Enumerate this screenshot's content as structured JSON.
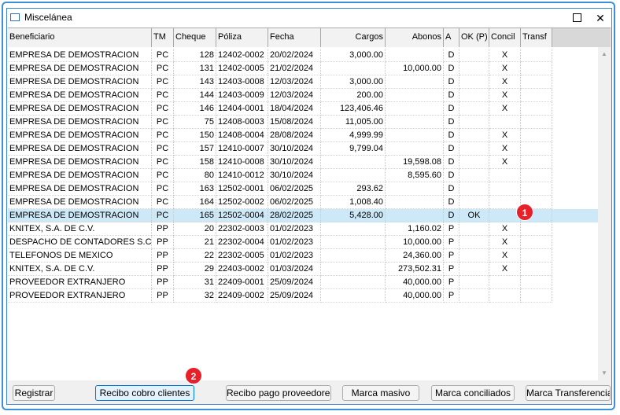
{
  "window": {
    "title": "Miscelánea"
  },
  "columns": [
    "Beneficiario",
    "TM",
    "Cheque",
    "Póliza",
    "Fecha",
    "Cargos",
    "Abonos",
    "A",
    "OK (P)",
    "Concil",
    "Transf"
  ],
  "rows": [
    [
      "EMPRESA DE DEMOSTRACION",
      "PC",
      "128",
      "12402-0002",
      "20/02/2024",
      "3,000.00",
      "",
      "D",
      "",
      "X",
      ""
    ],
    [
      "EMPRESA DE DEMOSTRACION",
      "PC",
      "131",
      "12402-0005",
      "21/02/2024",
      "",
      "10,000.00",
      "D",
      "",
      "X",
      ""
    ],
    [
      "EMPRESA DE DEMOSTRACION",
      "PC",
      "143",
      "12403-0008",
      "12/03/2024",
      "3,000.00",
      "",
      "D",
      "",
      "X",
      ""
    ],
    [
      "EMPRESA DE DEMOSTRACION",
      "PC",
      "144",
      "12403-0009",
      "12/03/2024",
      "200.00",
      "",
      "D",
      "",
      "X",
      ""
    ],
    [
      "EMPRESA DE DEMOSTRACION",
      "PC",
      "146",
      "12404-0001",
      "18/04/2024",
      "123,406.46",
      "",
      "D",
      "",
      "X",
      ""
    ],
    [
      "EMPRESA DE DEMOSTRACION",
      "PC",
      "75",
      "12408-0003",
      "15/08/2024",
      "11,005.00",
      "",
      "D",
      "",
      "",
      ""
    ],
    [
      "EMPRESA DE DEMOSTRACION",
      "PC",
      "150",
      "12408-0004",
      "28/08/2024",
      "4,999.99",
      "",
      "D",
      "",
      "X",
      ""
    ],
    [
      "EMPRESA DE DEMOSTRACION",
      "PC",
      "157",
      "12410-0007",
      "30/10/2024",
      "9,799.04",
      "",
      "D",
      "",
      "X",
      ""
    ],
    [
      "EMPRESA DE DEMOSTRACION",
      "PC",
      "158",
      "12410-0008",
      "30/10/2024",
      "",
      "19,598.08",
      "D",
      "",
      "X",
      ""
    ],
    [
      "EMPRESA DE DEMOSTRACION",
      "PC",
      "80",
      "12410-0012",
      "30/10/2024",
      "",
      "8,595.60",
      "D",
      "",
      "",
      ""
    ],
    [
      "EMPRESA DE DEMOSTRACION",
      "PC",
      "163",
      "12502-0001",
      "06/02/2025",
      "293.62",
      "",
      "D",
      "",
      "",
      ""
    ],
    [
      "EMPRESA DE DEMOSTRACION",
      "PC",
      "164",
      "12502-0002",
      "06/02/2025",
      "1,008.40",
      "",
      "D",
      "",
      "",
      ""
    ],
    [
      "EMPRESA DE DEMOSTRACION",
      "PC",
      "165",
      "12502-0004",
      "28/02/2025",
      "5,428.00",
      "",
      "D",
      "OK",
      "",
      ""
    ],
    [
      "KNITEX, S.A. DE C.V.",
      "PP",
      "20",
      "22302-0003",
      "01/02/2023",
      "",
      "1,160.02",
      "P",
      "",
      "X",
      ""
    ],
    [
      "DESPACHO DE CONTADORES S.C.",
      "PP",
      "21",
      "22302-0004",
      "01/02/2023",
      "",
      "10,000.00",
      "P",
      "",
      "X",
      ""
    ],
    [
      "TELEFONOS DE MEXICO",
      "PP",
      "22",
      "22302-0005",
      "01/02/2023",
      "",
      "24,360.00",
      "P",
      "",
      "X",
      ""
    ],
    [
      "KNITEX, S.A. DE C.V.",
      "PP",
      "29",
      "22403-0002",
      "01/03/2024",
      "",
      "273,502.31",
      "P",
      "",
      "X",
      ""
    ],
    [
      "PROVEEDOR EXTRANJERO",
      "PP",
      "31",
      "22409-0001",
      "25/09/2024",
      "",
      "40,000.00",
      "P",
      "",
      "",
      ""
    ],
    [
      "PROVEEDOR EXTRANJERO",
      "PP",
      "32",
      "22409-0002",
      "25/09/2024",
      "",
      "40,000.00",
      "P",
      "",
      "",
      ""
    ]
  ],
  "selected_row": 12,
  "buttons": {
    "registrar": "Registrar",
    "recibo_cobro": "Recibo cobro clientes",
    "recibo_pago": "Recibo pago proveedores",
    "marca_masivo": "Marca masivo",
    "marca_conciliados": "Marca conciliados",
    "marca_transferencias": "Marca Transferencias"
  },
  "callouts": [
    "1",
    "2"
  ],
  "colors": {
    "accent": "#0078d7",
    "selected_row": "#cde8f7",
    "callout": "#e8202a",
    "frame": "#3b8fd6"
  }
}
